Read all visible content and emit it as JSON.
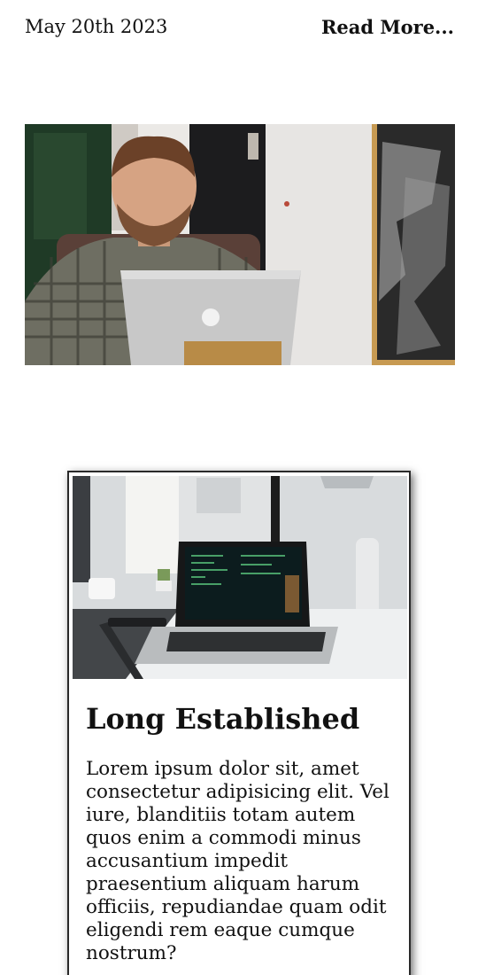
{
  "post_meta": {
    "date": "May 20th 2023",
    "read_more": "Read More..."
  },
  "card": {
    "title": "Long Established",
    "body": "Lorem ipsum dolor sit, amet consectetur adipisicing elit. Vel iure, blanditiis totam autem quos enim a commodi minus accusantium impedit praesentium aliquam harum officiis, repudiandae quam odit eligendi rem eaque cumque nostrum?"
  }
}
